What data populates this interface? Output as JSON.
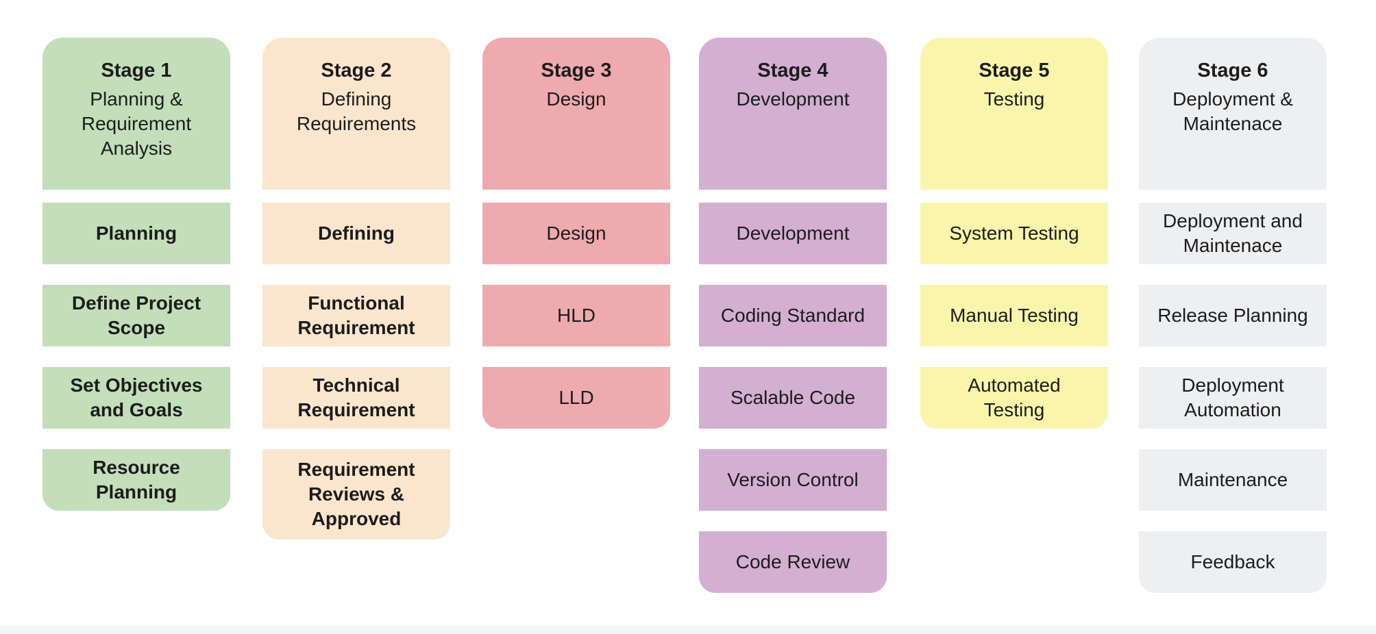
{
  "stages": [
    {
      "stage": "Stage 1",
      "name": "Planning & Requirement Analysis",
      "color": "#c2dfb9",
      "bold_items": true,
      "items": [
        "Planning",
        "Define Project Scope",
        "Set Objectives and Goals",
        "Resource Planning"
      ]
    },
    {
      "stage": "Stage 2",
      "name": "Defining Requirements",
      "color": "#fbe6cd",
      "bold_items": true,
      "items": [
        "Defining",
        "Functional Requirement",
        "Technical Requirement",
        "Requirement Reviews & Approved"
      ]
    },
    {
      "stage": "Stage 3",
      "name": "Design",
      "color": "#eeaaae",
      "bold_items": false,
      "items": [
        "Design",
        "HLD",
        "LLD"
      ]
    },
    {
      "stage": "Stage 4",
      "name": "Development",
      "color": "#d3afd1",
      "bold_items": false,
      "items": [
        "Development",
        "Coding Standard",
        "Scalable Code",
        "Version Control",
        "Code Review"
      ]
    },
    {
      "stage": "Stage 5",
      "name": "Testing",
      "color": "#f9f6ac",
      "bold_items": false,
      "items": [
        "System Testing",
        "Manual Testing",
        "Automated Testing"
      ]
    },
    {
      "stage": "Stage 6",
      "name": "Deployment & Maintenace",
      "color": "#eeeff1",
      "bold_items": false,
      "items": [
        "Deployment and Maintenace",
        "Release Planning",
        "Deployment Automation",
        "Maintenance",
        "Feedback"
      ]
    }
  ]
}
